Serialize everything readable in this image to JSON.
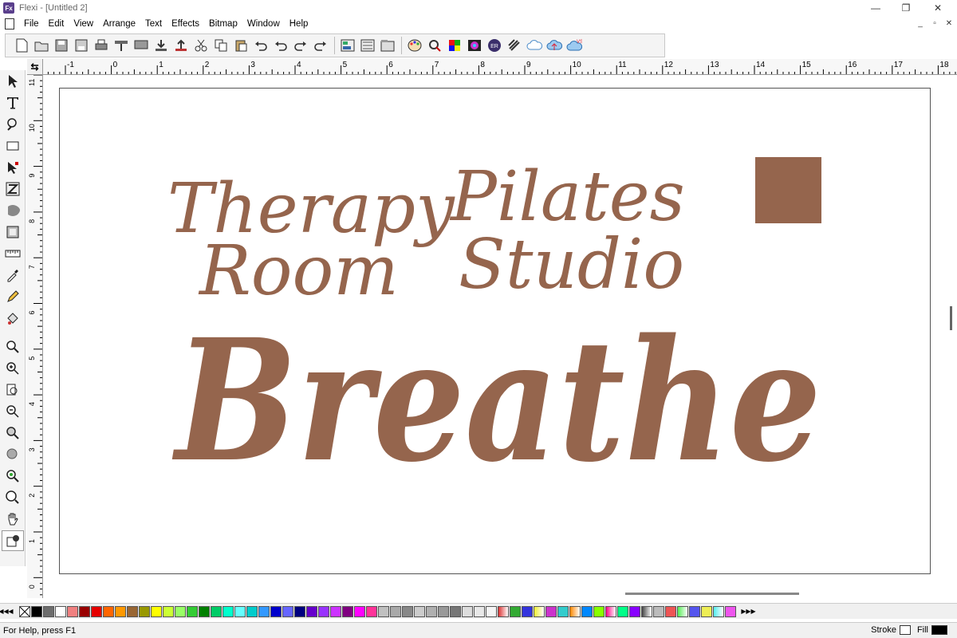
{
  "window": {
    "title": "Flexi - [Untitled 2]",
    "app_badge": "Fx"
  },
  "menu": [
    "File",
    "Edit",
    "View",
    "Arrange",
    "Text",
    "Effects",
    "Bitmap",
    "Window",
    "Help"
  ],
  "toolbar_icons": [
    "new-file",
    "open-file",
    "save-file",
    "save-as",
    "print",
    "plot",
    "cut-plot",
    "import",
    "export",
    "output",
    "cut",
    "copy",
    "paste",
    "undo",
    "redo",
    "redo-all",
    "repeat",
    "align",
    "distribute",
    "properties",
    "color-palette",
    "color-picker",
    "color-grid",
    "color-wheel",
    "er-badge",
    "hatch",
    "cloud",
    "cloud-upload",
    "cloud-upload-vs"
  ],
  "ruler": {
    "horizontal": [
      "-1",
      "0",
      "1",
      "2",
      "3",
      "4",
      "5",
      "6",
      "7",
      "8",
      "9",
      "10",
      "11",
      "12",
      "13",
      "14",
      "15",
      "16",
      "17",
      "18"
    ],
    "vertical": [
      "11",
      "10",
      "9",
      "8",
      "7",
      "6",
      "5",
      "4",
      "3",
      "2",
      "1",
      "0"
    ],
    "corner": "⇆"
  },
  "tools": [
    "select-arrow",
    "text-tool",
    "shape-edit",
    "rectangle",
    "node-edit",
    "zigzag",
    "fill-blob",
    "frame",
    "ruler-measure",
    "eyedropper",
    "pencil",
    "paint-bucket",
    "zoom-tool",
    "zoom-in",
    "zoom-page",
    "zoom-out",
    "zoom-fit",
    "zoom-selected",
    "zoom-all",
    "zoom-1to1",
    "hand-pan",
    "stroke-fill"
  ],
  "canvas": {
    "text_line1_left": "Therapy",
    "text_line2_left": "Room",
    "text_line1_right": "Pilates",
    "text_line2_right": "Studio",
    "text_big": "Breathe",
    "ink_color": "#95654d"
  },
  "palette": [
    "#000000",
    "#6e6e6e",
    "#ffffff",
    "#f08080",
    "#990000",
    "#e60000",
    "#ff6600",
    "#ff9900",
    "#996633",
    "#999900",
    "#ffff00",
    "#ccff33",
    "#99ff66",
    "#33cc33",
    "#008000",
    "#00cc66",
    "#00ffcc",
    "#66ffff",
    "#00cccc",
    "#3399ff",
    "#0000cc",
    "#6666ff",
    "#000080",
    "#6600cc",
    "#9933ff",
    "#cc33ff",
    "#800080",
    "#ff00ff",
    "#ff3399",
    "#c0c0c0",
    "#a9a9a9",
    "#888888",
    "#cccccc",
    "#b0b0b0",
    "#999999",
    "#777777",
    "#dddddd",
    "#e8e8e8",
    "#f5f5f5"
  ],
  "status": {
    "help": "For Help, press F1",
    "stroke_label": "Stroke",
    "fill_label": "Fill"
  }
}
